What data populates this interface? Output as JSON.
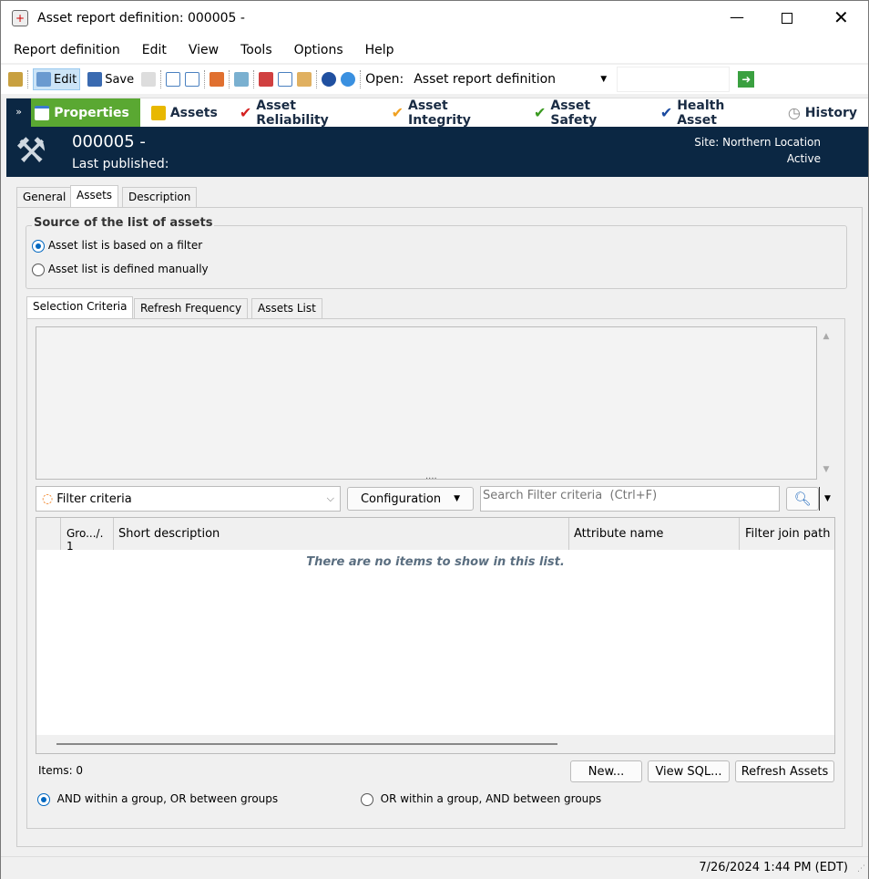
{
  "window": {
    "title": "Asset report definition: 000005 -"
  },
  "menu": [
    "Report definition",
    "Edit",
    "View",
    "Tools",
    "Options",
    "Help"
  ],
  "toolbar": {
    "edit": "Edit",
    "save": "Save",
    "open_label": "Open:",
    "open_value": "Asset report definition",
    "open_search": ""
  },
  "modules": [
    "Properties",
    "Assets",
    "Asset Reliability",
    "Asset Integrity",
    "Asset Safety",
    "Health Asset",
    "History"
  ],
  "module_colors": [
    "#4aa02c",
    "#e8b800",
    "#d42020",
    "#f0a020",
    "#3a9a20",
    "#1a4aa0",
    "#999999"
  ],
  "header": {
    "id": "000005 -",
    "published": "Last published:",
    "site": "Site: Northern Location",
    "status": "Active"
  },
  "tabs": [
    "General",
    "Assets",
    "Description"
  ],
  "source": {
    "legend": "Source of the list of assets",
    "opt1": "Asset list is based on a filter",
    "opt2": "Asset list is defined manually"
  },
  "subtabs": [
    "Selection Criteria",
    "Refresh Frequency",
    "Assets List"
  ],
  "filter": {
    "combo": "Filter criteria",
    "config": "Configuration",
    "search_placeholder": "Search Filter criteria  (Ctrl+F)"
  },
  "grid": {
    "columns": [
      "Gro.../. 1",
      "Short description",
      "Attribute name",
      "Filter join path"
    ],
    "empty": "There are no items to show in this list."
  },
  "items": "Items: 0",
  "buttons": {
    "new": "New...",
    "sql": "View SQL...",
    "refresh": "Refresh Assets"
  },
  "logic": {
    "opt1": "AND within a group, OR between groups",
    "opt2": "OR within a group, AND between groups"
  },
  "status": "7/26/2024 1:44 PM (EDT)"
}
